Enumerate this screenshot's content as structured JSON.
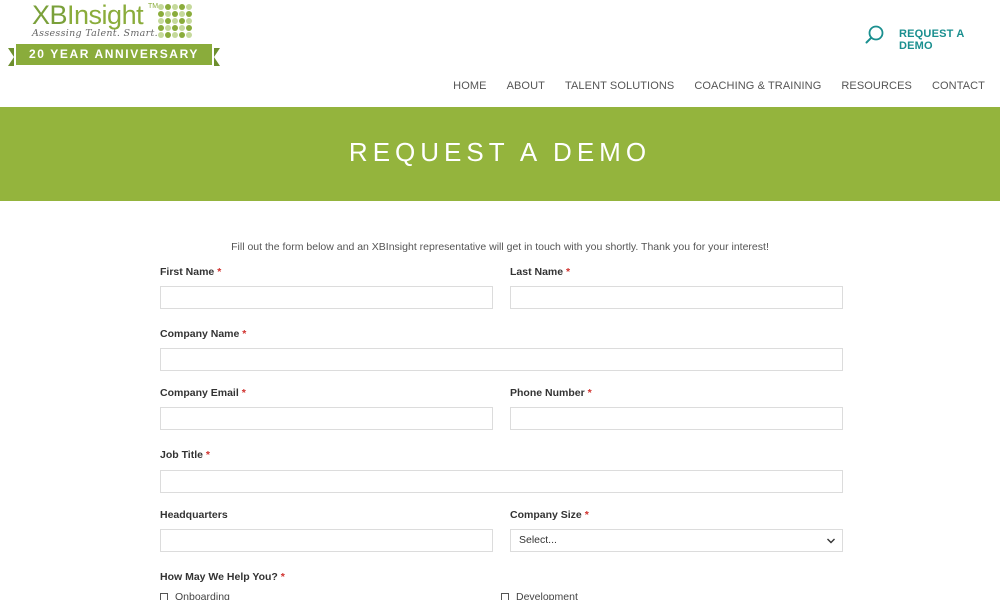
{
  "header": {
    "logo": {
      "brand_xb": "XB",
      "brand_rest": "Insight",
      "tm": "TM",
      "tagline": "Assessing Talent. Smart.",
      "banner": "20 YEAR ANNIVERSARY"
    },
    "search_icon": "search-icon",
    "cta_label": "REQUEST A DEMO",
    "nav": [
      "HOME",
      "ABOUT",
      "TALENT SOLUTIONS",
      "COACHING & TRAINING",
      "RESOURCES",
      "CONTACT"
    ]
  },
  "hero": {
    "title": "REQUEST A DEMO",
    "background": "#94b43d"
  },
  "form": {
    "intro": "Fill out the form below and an XBInsight representative will get in touch with you shortly. Thank you for your interest!",
    "required_mark": "*",
    "fields": {
      "first_name": "First Name",
      "last_name": "Last Name",
      "company_name": "Company Name",
      "company_email": "Company Email",
      "phone_number": "Phone Number",
      "job_title": "Job Title",
      "headquarters": "Headquarters",
      "company_size": "Company Size",
      "help": "How May We Help You?"
    },
    "company_size_selected": "Select...",
    "help_options": [
      "Onboarding",
      "Development"
    ]
  },
  "colors": {
    "brand_green": "#8aac3b",
    "accent_teal": "#1a8f8f",
    "required_red": "#d0312d"
  }
}
